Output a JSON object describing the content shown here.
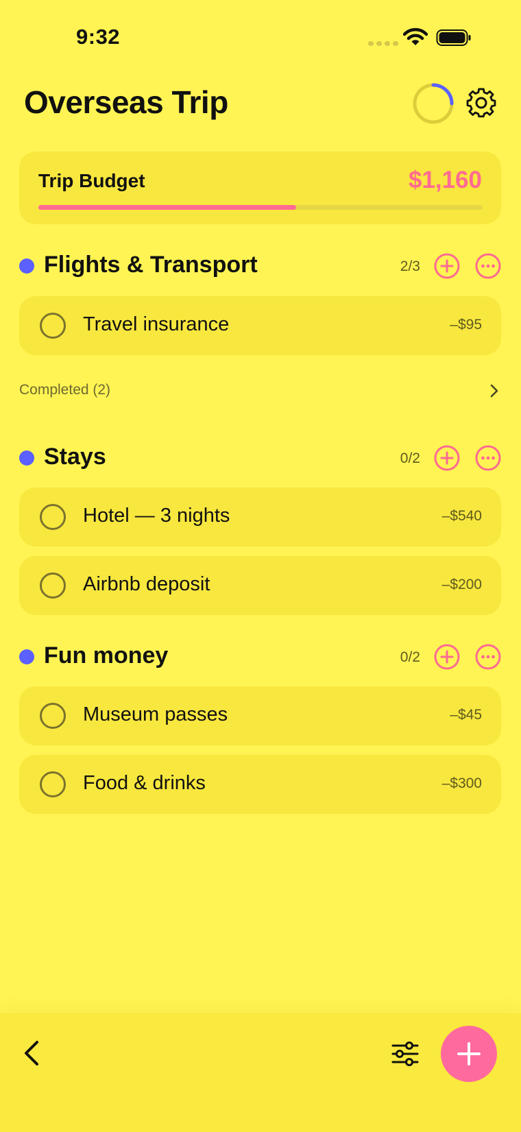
{
  "status_bar": {
    "time": "9:32"
  },
  "header": {
    "title": "Overseas Trip"
  },
  "budget": {
    "label": "Trip Budget",
    "amount": "$1,160",
    "spent_fraction": 0.58
  },
  "sections": [
    {
      "title": "Flights & Transport",
      "count": "2/3",
      "items": [
        {
          "label": "Travel insurance",
          "amount": "–$95"
        }
      ],
      "completed_label": "Completed (2)"
    },
    {
      "title": "Stays",
      "count": "0/2",
      "items": [
        {
          "label": "Hotel — 3 nights",
          "amount": "–$540"
        },
        {
          "label": "Airbnb deposit",
          "amount": "–$200"
        }
      ]
    },
    {
      "title": "Fun money",
      "count": "0/2",
      "items": [
        {
          "label": "Museum passes",
          "amount": "–$45"
        },
        {
          "label": "Food & drinks",
          "amount": "–$300"
        }
      ]
    }
  ],
  "icons": {
    "progress_ring": "progress-ring-icon",
    "settings": "gear-icon",
    "add": "plus-circle-icon",
    "more": "ellipsis-circle-icon",
    "back": "chevron-left-icon",
    "filter": "sliders-icon",
    "fab": "plus-icon"
  },
  "colors": {
    "background": "#FFF453",
    "card": "#F8E73E",
    "accent_pink": "#FF6A93",
    "section_dot": "#5B60FF"
  }
}
